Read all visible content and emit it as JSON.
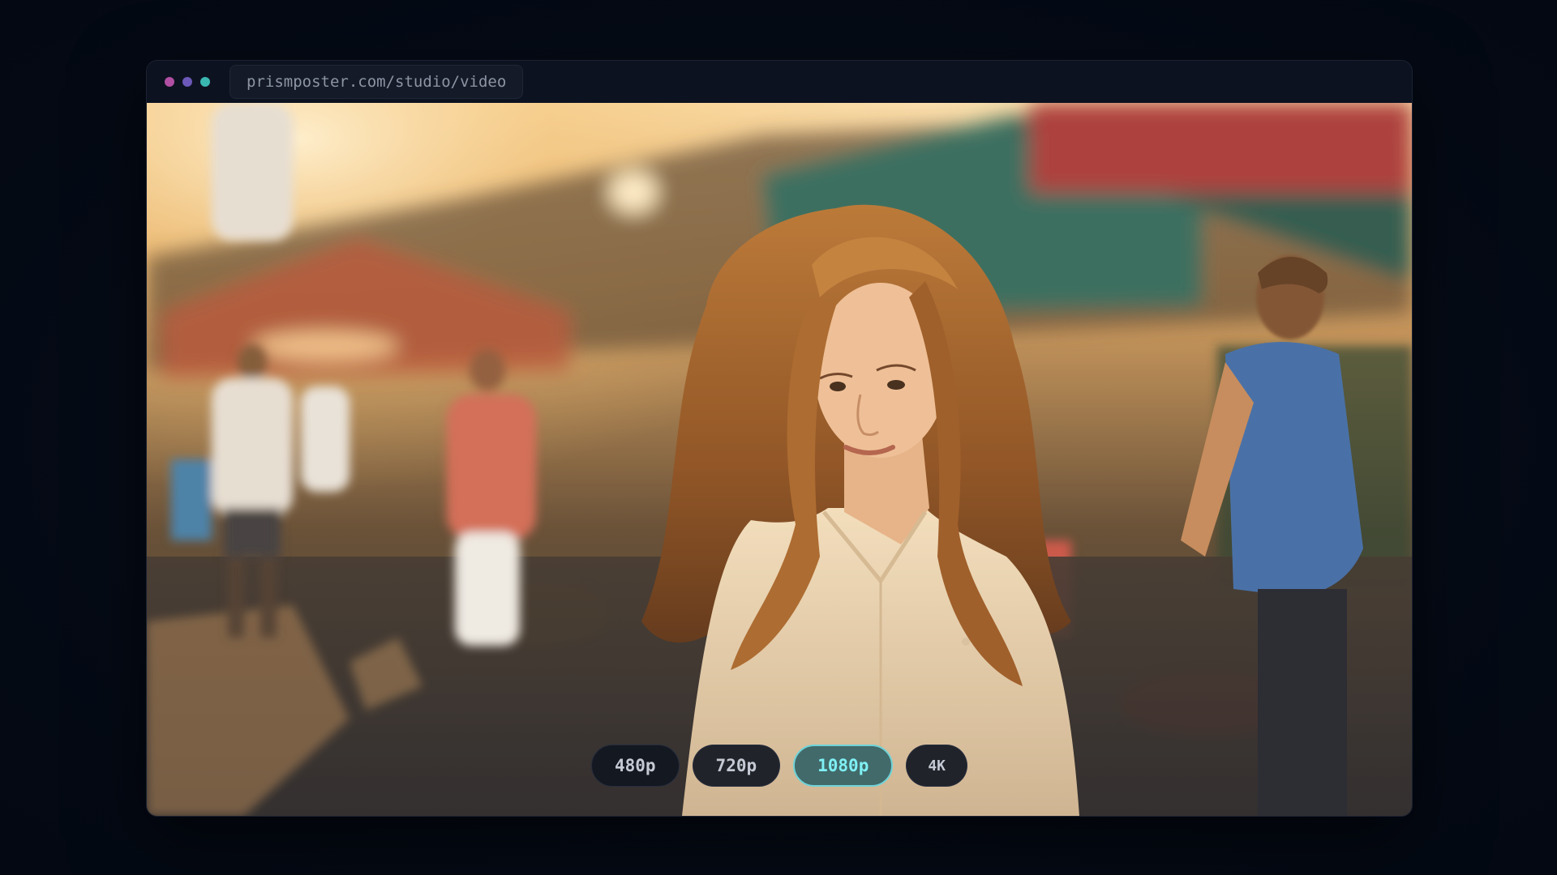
{
  "window": {
    "controls": [
      {
        "name": "close",
        "color": "#b04fa3"
      },
      {
        "name": "minimize",
        "color": "#6b58b8"
      },
      {
        "name": "maximize",
        "color": "#3bb7b2"
      }
    ],
    "url": "prismposter.com/studio/video"
  },
  "video": {
    "scene": "video-frame"
  },
  "quality": {
    "options": [
      "480p",
      "720p",
      "1080p",
      "4K"
    ],
    "selected": "1080p"
  }
}
